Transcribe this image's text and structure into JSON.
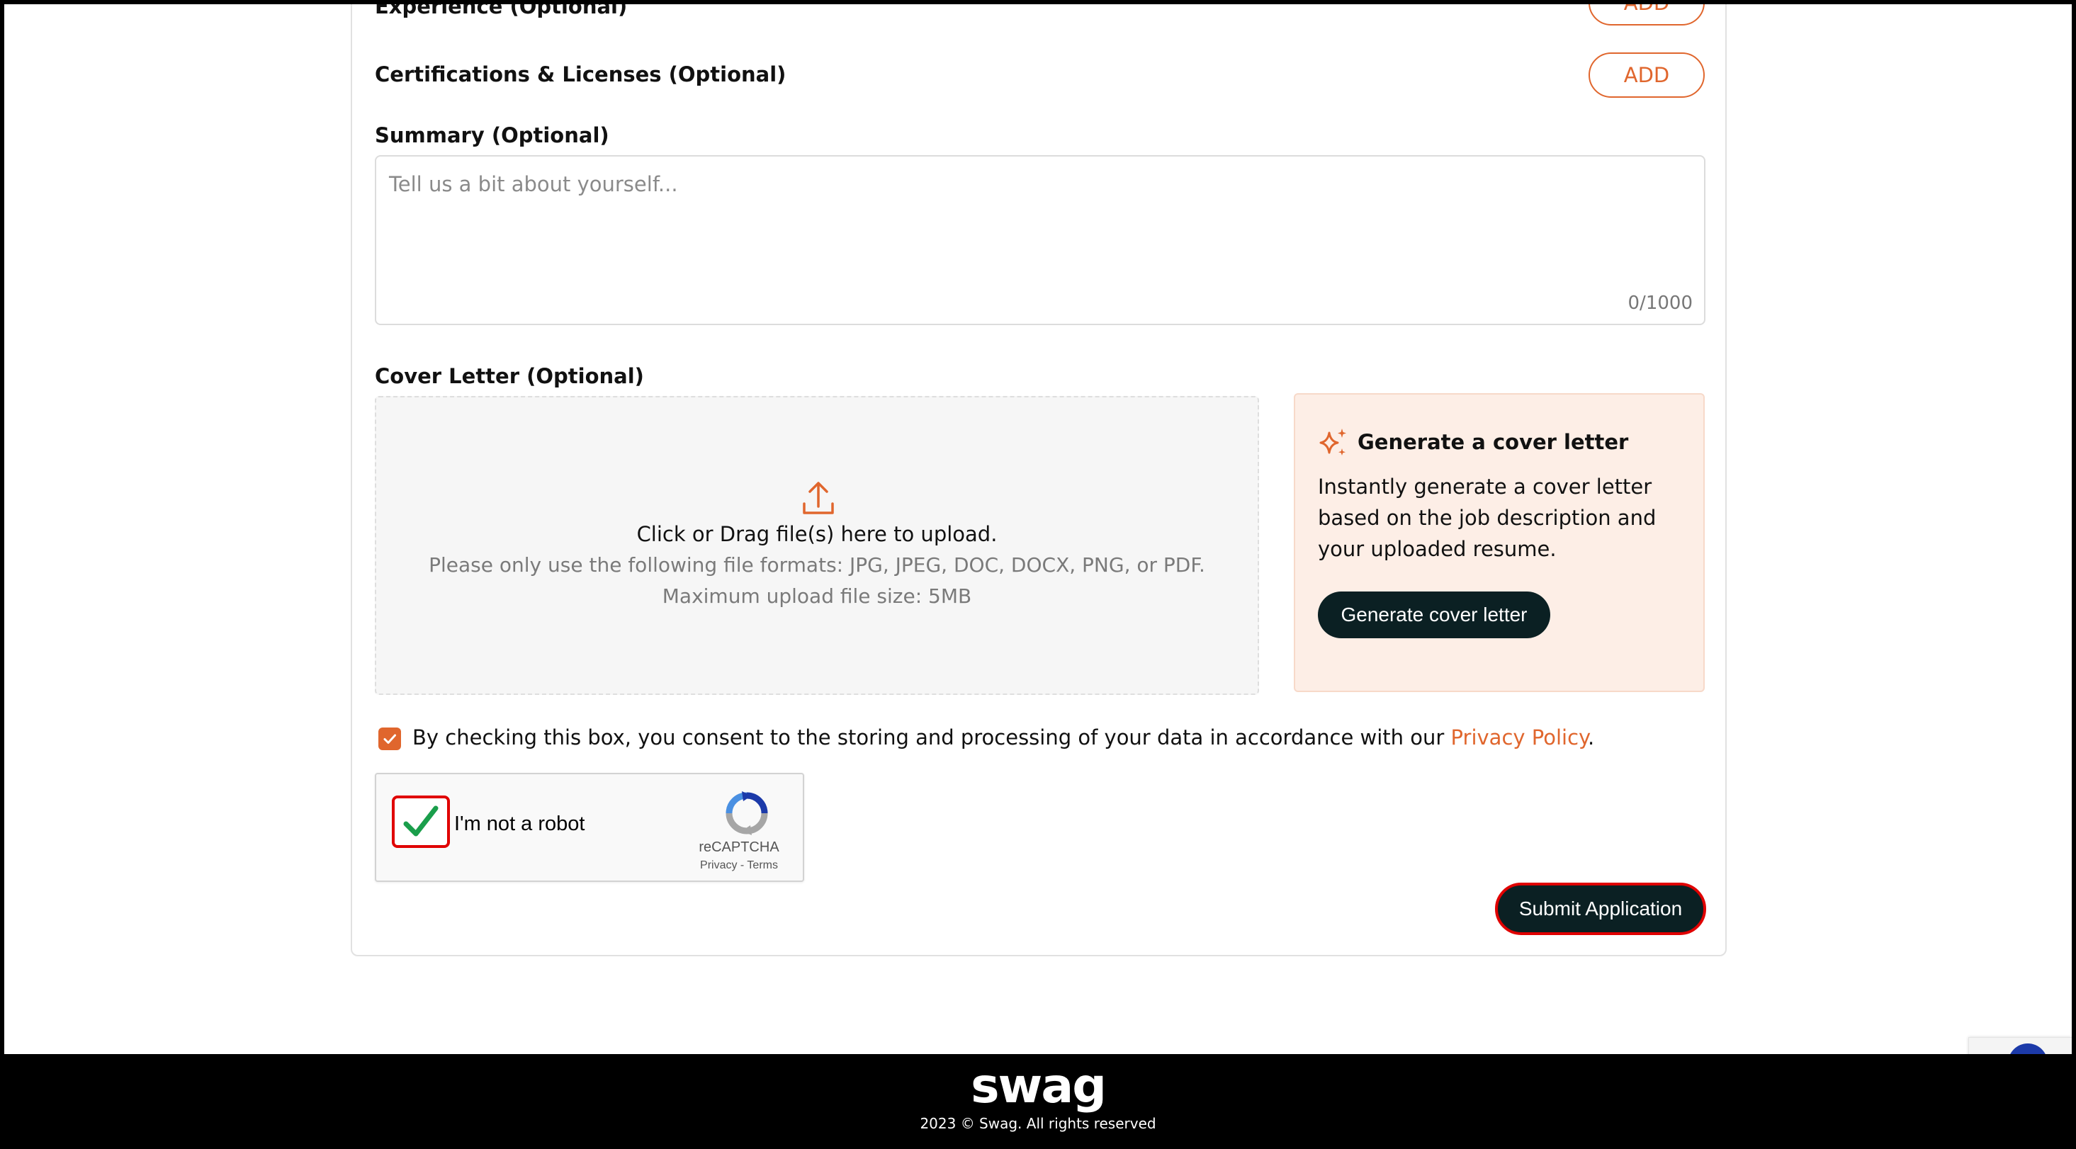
{
  "form": {
    "experience": {
      "label": "Experience (Optional)",
      "add_label": "ADD"
    },
    "certifications": {
      "label": "Certifications & Licenses (Optional)",
      "add_label": "ADD"
    },
    "summary": {
      "label": "Summary (Optional)",
      "placeholder": "Tell us a bit about yourself...",
      "char_count": "0/1000"
    },
    "cover_letter": {
      "label": "Cover Letter (Optional)",
      "upload_title": "Click or Drag file(s) here to upload.",
      "upload_formats": "Please only use the following file formats: JPG, JPEG, DOC, DOCX, PNG, or PDF.",
      "upload_max": "Maximum upload file size: 5MB"
    },
    "generate": {
      "title": "Generate a cover letter",
      "description": "Instantly generate a cover letter based on the job description and your uploaded resume.",
      "button_label": "Generate cover letter"
    },
    "consent": {
      "text": "By checking this box, you consent to the storing and processing of your data in accordance with our ",
      "link_label": "Privacy Policy",
      "suffix": ".",
      "checked": true
    },
    "recaptcha": {
      "label": "I'm not a robot",
      "brand": "reCAPTCHA",
      "links": "Privacy - Terms",
      "checked": true
    },
    "submit_label": "Submit Application"
  },
  "footer": {
    "logo_text": "swag",
    "copyright": "2023 © Swag. All rights reserved"
  },
  "colors": {
    "accent": "#e0662d",
    "dark_button": "#0b2023",
    "panel_bg": "#fdeee6",
    "highlight_red": "#e00000",
    "check_green": "#1a9e4b"
  },
  "icons": {
    "upload": "upload-icon",
    "sparkle": "sparkle-icon",
    "checkmark": "checkmark-icon",
    "recaptcha_logo": "recaptcha-logo-icon"
  }
}
